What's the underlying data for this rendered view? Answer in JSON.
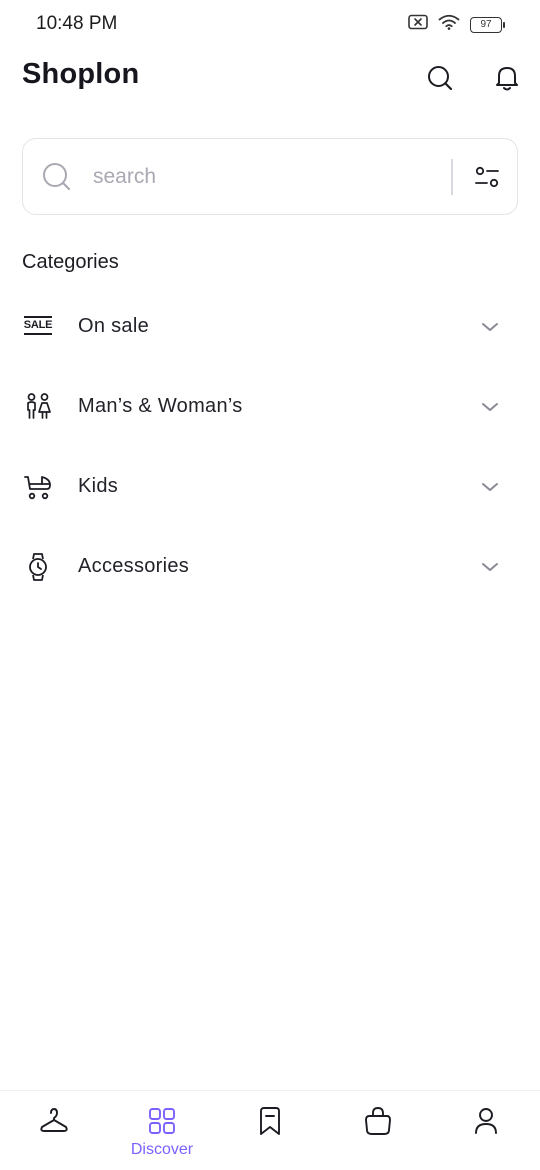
{
  "status_bar": {
    "time": "10:48 PM",
    "battery": "97",
    "icons": [
      "screen-record-icon",
      "wifi-icon",
      "battery-icon"
    ]
  },
  "header": {
    "title": "Shoplon",
    "actions": [
      "search-icon",
      "bell-icon"
    ]
  },
  "search": {
    "placeholder": "search",
    "value": "",
    "filter_icon": "filter-icon"
  },
  "categories": {
    "title": "Categories",
    "items": [
      {
        "label": "On sale",
        "icon": "sale-icon",
        "badge_text": "SALE"
      },
      {
        "label": "Man’s & Woman’s",
        "icon": "people-icon"
      },
      {
        "label": "Kids",
        "icon": "stroller-icon"
      },
      {
        "label": "Accessories",
        "icon": "watch-icon"
      }
    ]
  },
  "bottom_nav": {
    "active_index": 1,
    "items": [
      {
        "icon": "hanger-icon",
        "label": ""
      },
      {
        "icon": "grid-icon",
        "label": "Discover"
      },
      {
        "icon": "bookmark-icon",
        "label": ""
      },
      {
        "icon": "bag-icon",
        "label": ""
      },
      {
        "icon": "profile-icon",
        "label": ""
      }
    ]
  },
  "colors": {
    "accent": "#7b61ff",
    "text": "#1c1c23",
    "muted": "#a9a9b3",
    "border": "#e3e3ea"
  }
}
